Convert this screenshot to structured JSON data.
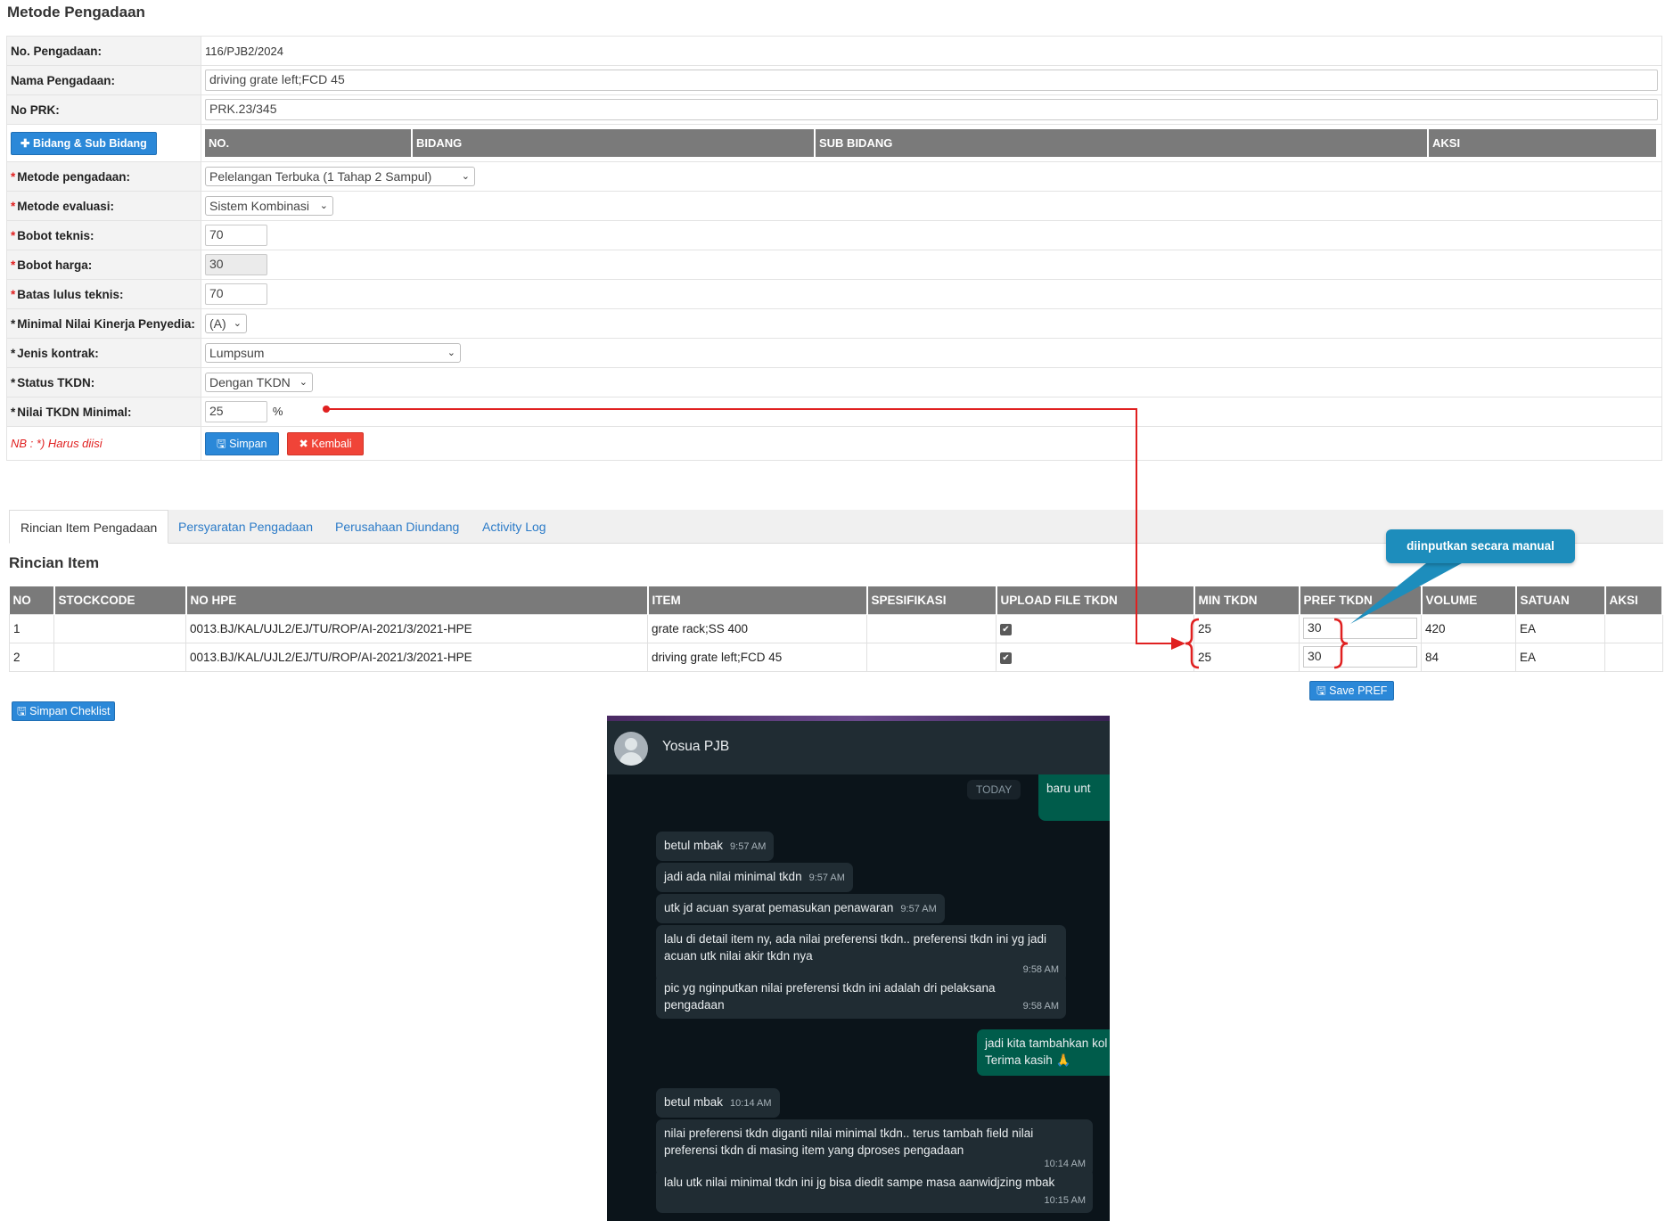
{
  "page_title": "Metode Pengadaan",
  "form": {
    "no_pengadaan_label": "No. Pengadaan:",
    "no_pengadaan_value": "116/PJB2/2024",
    "nama_label": "Nama Pengadaan:",
    "nama_value": "driving grate left;FCD 45",
    "no_prk_label": "No PRK:",
    "no_prk_value": "PRK.23/345",
    "bidang_button": "Bidang & Sub Bidang",
    "bidang_headers": [
      "NO.",
      "BIDANG",
      "SUB BIDANG",
      "AKSI"
    ],
    "metode_label": "Metode pengadaan:",
    "metode_value": "Pelelangan Terbuka (1 Tahap 2 Sampul)",
    "evaluasi_label": "Metode evaluasi:",
    "evaluasi_value": "Sistem Kombinasi",
    "bobot_teknis_label": "Bobot teknis:",
    "bobot_teknis_value": "70",
    "bobot_harga_label": "Bobot harga:",
    "bobot_harga_value": "30",
    "batas_label": "Batas lulus teknis:",
    "batas_value": "70",
    "kinerja_label": "Minimal Nilai Kinerja Penyedia:",
    "kinerja_value": "(A)",
    "kontrak_label": "Jenis kontrak:",
    "kontrak_value": "Lumpsum",
    "tkdn_status_label": "Status TKDN:",
    "tkdn_status_value": "Dengan TKDN",
    "tkdn_min_label": "Nilai TKDN Minimal:",
    "tkdn_min_value": "25",
    "percent": "%",
    "nb": "NB : *) Harus diisi",
    "save_button": "Simpan",
    "back_button": "Kembali",
    "asterisk": "*"
  },
  "tabs": [
    "Rincian Item Pengadaan",
    "Persyaratan Pengadaan",
    "Perusahaan Diundang",
    "Activity Log"
  ],
  "section_title": "Rincian Item",
  "items_table": {
    "headers": [
      "NO",
      "STOCKCODE",
      "NO HPE",
      "ITEM",
      "SPESIFIKASI",
      "UPLOAD FILE TKDN",
      "MIN TKDN",
      "PREF TKDN",
      "VOLUME",
      "SATUAN",
      "AKSI"
    ],
    "rows": [
      {
        "no": "1",
        "stockcode": "",
        "hpe": "0013.BJ/KAL/UJL2/EJ/TU/ROP/AI-2021/3/2021-HPE",
        "item": "grate rack;SS 400",
        "spesifikasi": "",
        "min": "25",
        "pref": "30",
        "volume": "420",
        "satuan": "EA",
        "aksi": ""
      },
      {
        "no": "2",
        "stockcode": "",
        "hpe": "0013.BJ/KAL/UJL2/EJ/TU/ROP/AI-2021/3/2021-HPE",
        "item": "driving grate left;FCD 45",
        "spesifikasi": "",
        "min": "25",
        "pref": "30",
        "volume": "84",
        "satuan": "EA",
        "aksi": ""
      }
    ],
    "save_pref_button": "Save PREF"
  },
  "simpan_checklist_button": "Simpan Cheklist",
  "callout_text": "diinputkan secara manual",
  "colors": {
    "accent_blue": "#2b88d8",
    "danger_red": "#f04438",
    "annotation_red": "#e02020",
    "callout_blue": "#1d8dbc"
  },
  "chat": {
    "contact": "Yosua PJB",
    "today": "TODAY",
    "messages": [
      {
        "text": "baru unt",
        "time": "",
        "out": true
      },
      {
        "text": "betul mbak",
        "time": "9:57 AM",
        "out": false
      },
      {
        "text": "jadi ada nilai minimal tkdn",
        "time": "9:57 AM",
        "out": false
      },
      {
        "text": "utk jd acuan syarat pemasukan penawaran",
        "time": "9:57 AM",
        "out": false
      },
      {
        "text": "lalu di detail item ny, ada nilai preferensi tkdn.. preferensi tkdn ini yg jadi acuan utk nilai akir tkdn nya",
        "time": "9:58 AM",
        "out": false
      },
      {
        "text": "pic yg nginputkan nilai preferensi tkdn ini adalah dri pelaksana pengadaan",
        "time": "9:58 AM",
        "out": false
      },
      {
        "text": "jadi kita tambahkan kol",
        "time": "",
        "out": true
      },
      {
        "text": "Terima kasih 🙏",
        "time": "",
        "out": true
      },
      {
        "text": "betul mbak",
        "time": "10:14 AM",
        "out": false
      },
      {
        "text": "nilai preferensi tkdn diganti nilai minimal tkdn.. terus tambah field nilai preferensi tkdn di masing item yang dproses pengadaan",
        "time": "10:14 AM",
        "out": false
      },
      {
        "text": "lalu utk nilai minimal tkdn ini jg bisa diedit sampe masa aanwidjzing mbak",
        "time": "10:15 AM",
        "out": false
      }
    ]
  }
}
